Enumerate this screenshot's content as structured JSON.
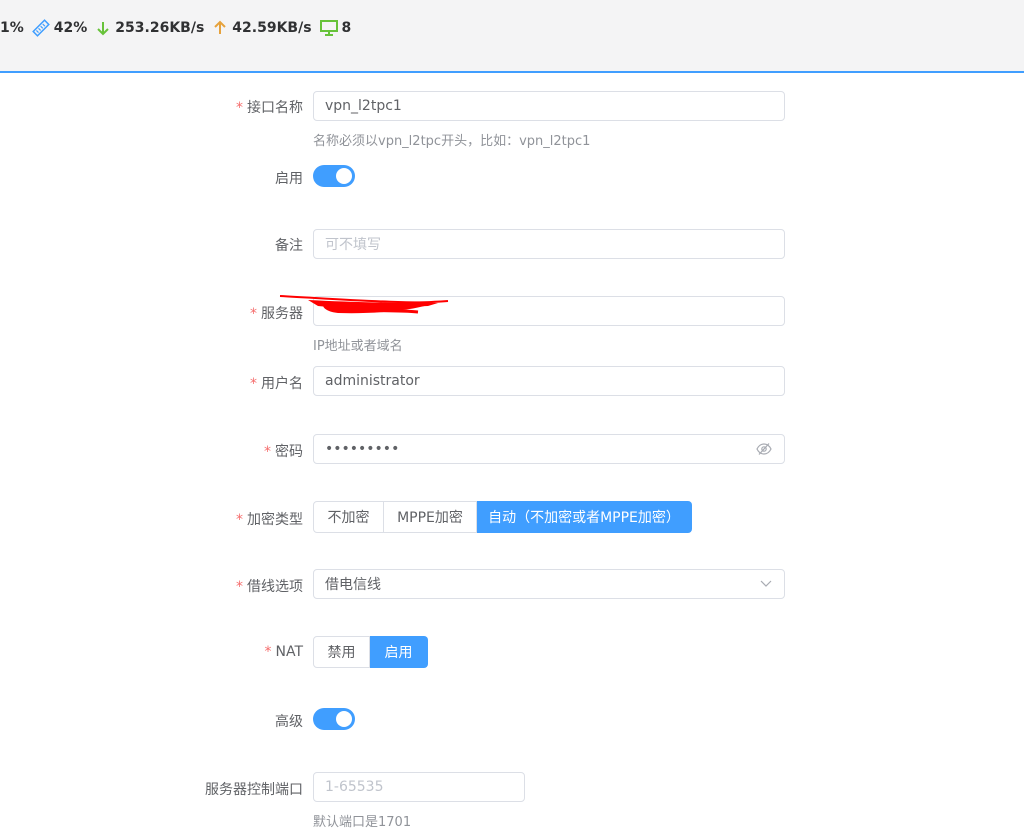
{
  "status": {
    "cpu": "1%",
    "mem": "42%",
    "down": "253.26KB/s",
    "up": "42.59KB/s",
    "clients": "8"
  },
  "form": {
    "iface_label": "接口名称",
    "iface_value": "vpn_l2tpc1",
    "iface_hint": "名称必须以vpn_l2tpc开头，比如：vpn_l2tpc1",
    "enable_label": "启用",
    "enable_on": true,
    "remark_label": "备注",
    "remark_placeholder": "可不填写",
    "server_label": "服务器",
    "server_hint": "IP地址或者域名",
    "user_label": "用户名",
    "user_value": "administrator",
    "pass_label": "密码",
    "pass_value": "•••••••••",
    "enc_label": "加密类型",
    "enc_options": [
      "不加密",
      "MPPE加密",
      "自动（不加密或者MPPE加密）"
    ],
    "enc_selected": "自动（不加密或者MPPE加密）",
    "line_label": "借线选项",
    "line_value": "借电信线",
    "nat_label": "NAT",
    "nat_options": [
      "禁用",
      "启用"
    ],
    "nat_selected": "启用",
    "adv_label": "高级",
    "adv_on": true,
    "port_label": "服务器控制端口",
    "port_placeholder": "1-65535",
    "port_hint": "默认端口是1701"
  },
  "colors": {
    "accent": "#409eff",
    "required": "#f56c6c",
    "download": "#67c23a",
    "upload": "#e6a23c",
    "redaction": "#ff0000"
  }
}
